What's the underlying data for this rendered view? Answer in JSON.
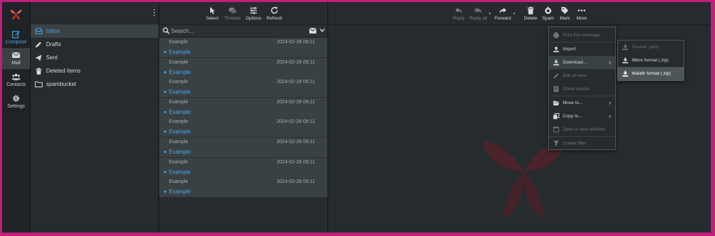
{
  "nav": {
    "items": [
      {
        "label": "Compose"
      },
      {
        "label": "Mail"
      },
      {
        "label": "Contacts"
      },
      {
        "label": "Settings"
      }
    ]
  },
  "folders": [
    {
      "label": "Inbox",
      "icon": "inbox-icon"
    },
    {
      "label": "Drafts",
      "icon": "pencil-icon"
    },
    {
      "label": "Sent",
      "icon": "paper-plane-icon"
    },
    {
      "label": "Deleted Items",
      "icon": "trash-icon"
    },
    {
      "label": "spambucket",
      "icon": "folder-icon"
    }
  ],
  "list_toolbar": {
    "select": "Select",
    "threads": "Threads",
    "options": "Options",
    "refresh": "Refresh"
  },
  "search": {
    "placeholder": "Search..."
  },
  "messages": [
    {
      "from": "Example",
      "date": "2024-02-28 09:11",
      "subject": "Example"
    },
    {
      "from": "Example",
      "date": "2024-02-28 09:11",
      "subject": "Example"
    },
    {
      "from": "Example",
      "date": "2024-02-28 09:11",
      "subject": "Example"
    },
    {
      "from": "Example",
      "date": "2024-02-28 09:11",
      "subject": "Example"
    },
    {
      "from": "Example",
      "date": "2024-02-28 09:11",
      "subject": "Example"
    },
    {
      "from": "Example",
      "date": "2024-02-28 09:11",
      "subject": "Example"
    },
    {
      "from": "Example",
      "date": "2024-02-28 09:11",
      "subject": "Example"
    },
    {
      "from": "Example",
      "date": "2024-02-28 09:11",
      "subject": "Example"
    }
  ],
  "content_toolbar": {
    "reply": "Reply",
    "reply_all": "Reply all",
    "forward": "Forward",
    "delete": "Delete",
    "spam": "Spam",
    "mark": "Mark",
    "more": "More"
  },
  "more_menu": {
    "print": "Print this message",
    "import": "Import",
    "download": "Download...",
    "edit_as_new": "Edit as new",
    "show_source": "Show source",
    "move_to": "Move to...",
    "copy_to": "Copy to...",
    "open_new_window": "Open in new window",
    "create_filter": "Create filter"
  },
  "download_menu": {
    "source": "Source (.eml)",
    "mbox": "Mbox format (.zip)",
    "maildir": "Maildir format (.zip)"
  },
  "colors": {
    "accent": "#4aa6e8",
    "brand": "#c01f7a",
    "logo": "#c0392b"
  }
}
